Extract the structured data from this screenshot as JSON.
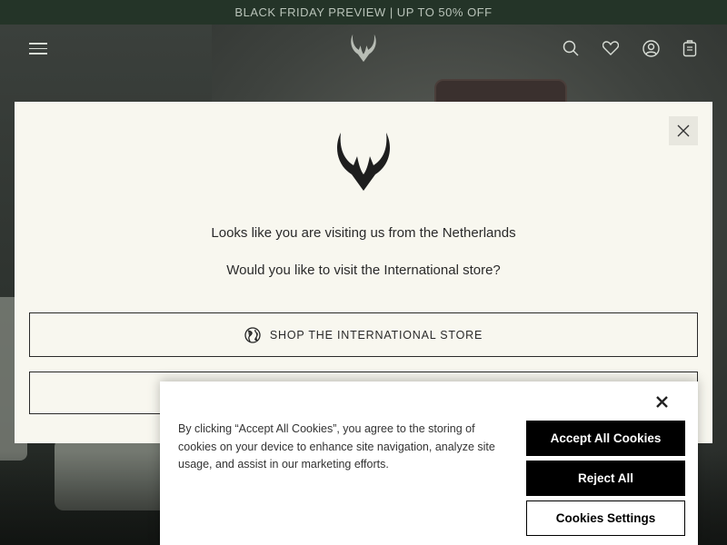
{
  "promo": {
    "text": "BLACK FRIDAY PREVIEW | UP TO 50% OFF"
  },
  "header": {
    "icons": [
      "menu-icon",
      "logo-antlers",
      "search-icon",
      "heart-icon",
      "account-icon",
      "bag-icon"
    ]
  },
  "modal": {
    "line1": "Looks like you are visiting us from the Netherlands",
    "line2": "Would you like to visit the International store?",
    "shop_button_label": "SHOP THE INTERNATIONAL STORE",
    "shop_button_icon": "globe-icon",
    "second_button_label": ""
  },
  "cookie": {
    "text": "By clicking “Accept All Cookies”, you agree to the storing of cookies on your device to enhance site navigation, analyze site usage, and assist in our marketing efforts.",
    "accept_label": "Accept All Cookies",
    "reject_label": "Reject All",
    "settings_label": "Cookies Settings"
  },
  "colors": {
    "promo_bg": "#243428",
    "modal_bg": "#f8f7ef",
    "button_dark": "#000000"
  }
}
